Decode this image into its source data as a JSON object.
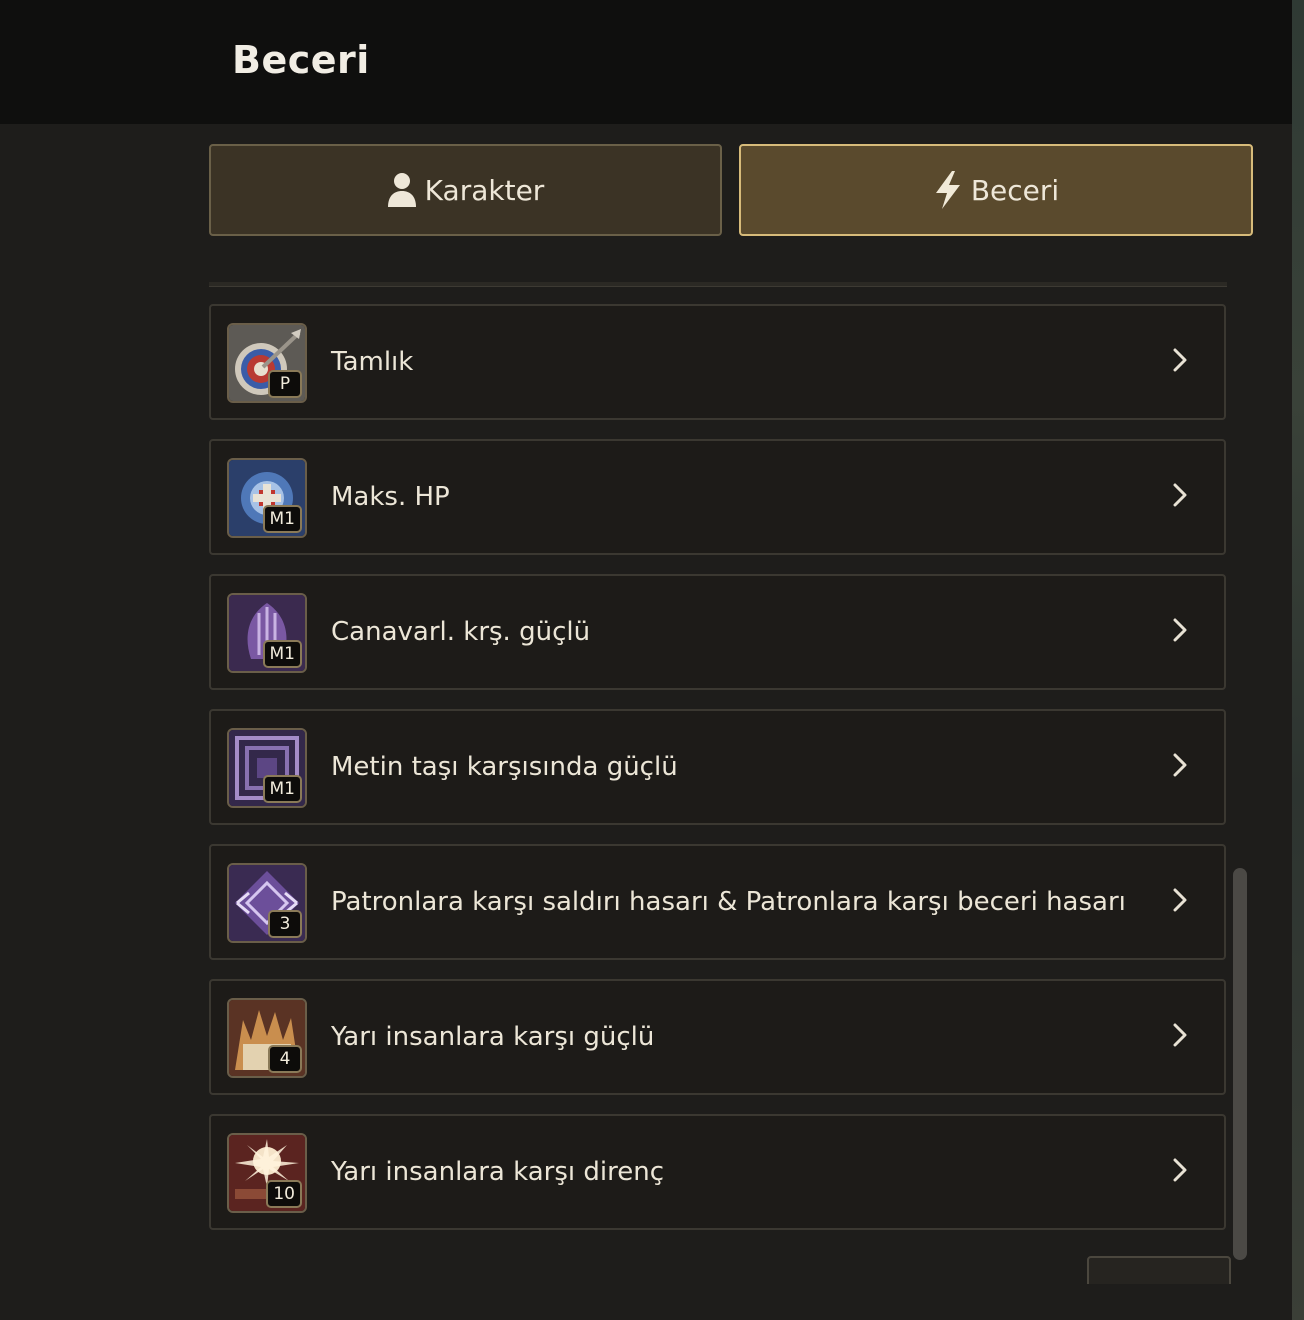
{
  "header": {
    "title": "Beceri"
  },
  "tabs": [
    {
      "label": "Karakter",
      "icon": "person-icon",
      "active": false
    },
    {
      "label": "Beceri",
      "icon": "lightning-icon",
      "active": true
    }
  ],
  "skills": [
    {
      "name": "Tamlık",
      "badge": "P",
      "icon": "target-icon"
    },
    {
      "name": "Maks. HP",
      "badge": "M1",
      "icon": "max-hp-icon"
    },
    {
      "name": "Canavarl. krş. güçlü",
      "badge": "M1",
      "icon": "monster-strong-icon"
    },
    {
      "name": "Metin taşı karşısında güçlü",
      "badge": "M1",
      "icon": "metin-stone-icon"
    },
    {
      "name": "Patronlara karşı saldırı hasarı & Patronlara karşı beceri hasarı",
      "badge": "3",
      "icon": "boss-damage-icon"
    },
    {
      "name": "Yarı insanlara karşı güçlü",
      "badge": "4",
      "icon": "half-human-strong-icon"
    },
    {
      "name": "Yarı insanlara karşı direnç",
      "badge": "10",
      "icon": "half-human-resist-icon"
    }
  ],
  "colors": {
    "accent_border": "#d7bb7a",
    "active_tab_bg": "#5a4a2d",
    "row_bg": "#1d1b18"
  }
}
